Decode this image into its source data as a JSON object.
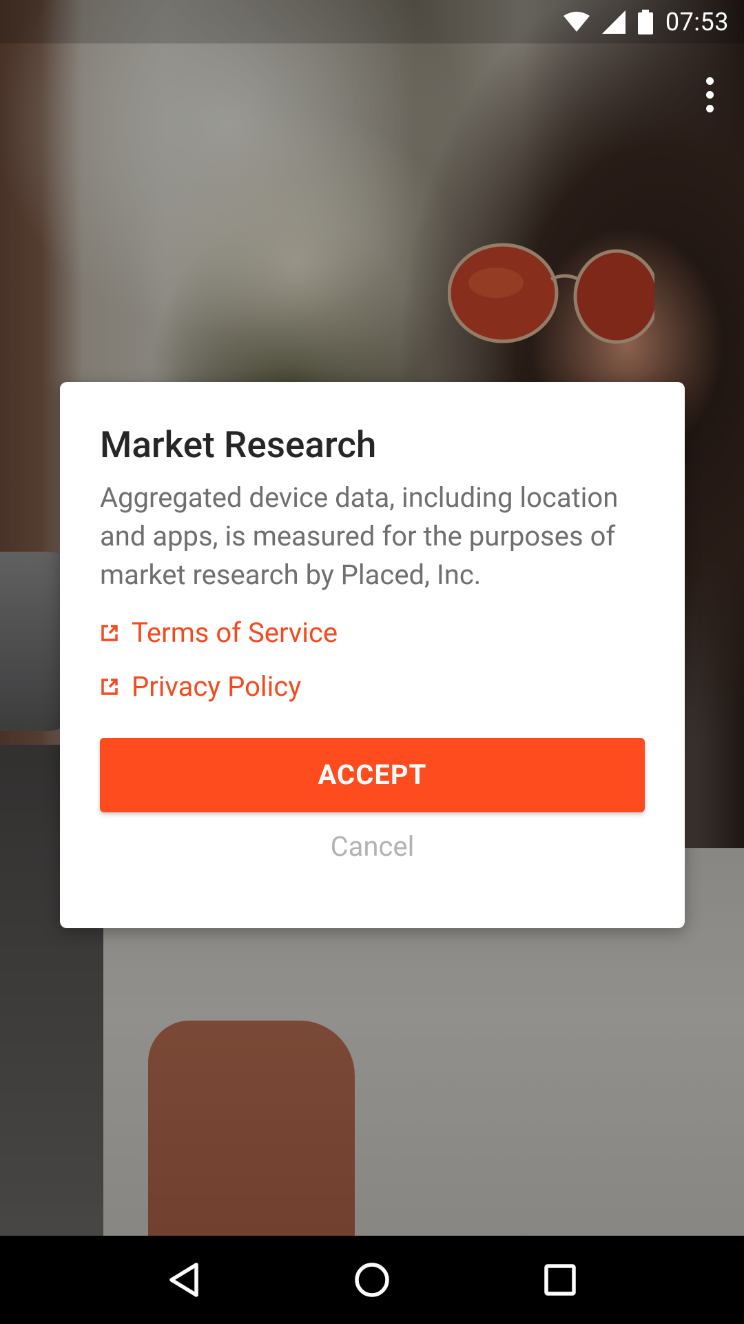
{
  "status_bar": {
    "time": "07:53",
    "icons": [
      "wifi-icon",
      "cellular-signal-icon",
      "battery-icon"
    ]
  },
  "app_bar": {
    "overflow_icon": "more-vert-icon"
  },
  "dialog": {
    "title": "Market Research",
    "body": "Aggregated device data, including location and apps, is measured for the purposes of market research by Placed, Inc.",
    "links": [
      {
        "label": "Terms of Service",
        "icon": "external-link-icon"
      },
      {
        "label": "Privacy Policy",
        "icon": "external-link-icon"
      }
    ],
    "accept_label": "ACCEPT",
    "cancel_label": "Cancel"
  },
  "nav_bar": {
    "buttons": [
      "back-icon",
      "home-icon",
      "recents-icon"
    ]
  },
  "colors": {
    "accent": "#ff4c1f",
    "link": "#f24b20",
    "title": "#262626",
    "body": "#6f6f6f",
    "cancel": "#b3b3b3"
  }
}
